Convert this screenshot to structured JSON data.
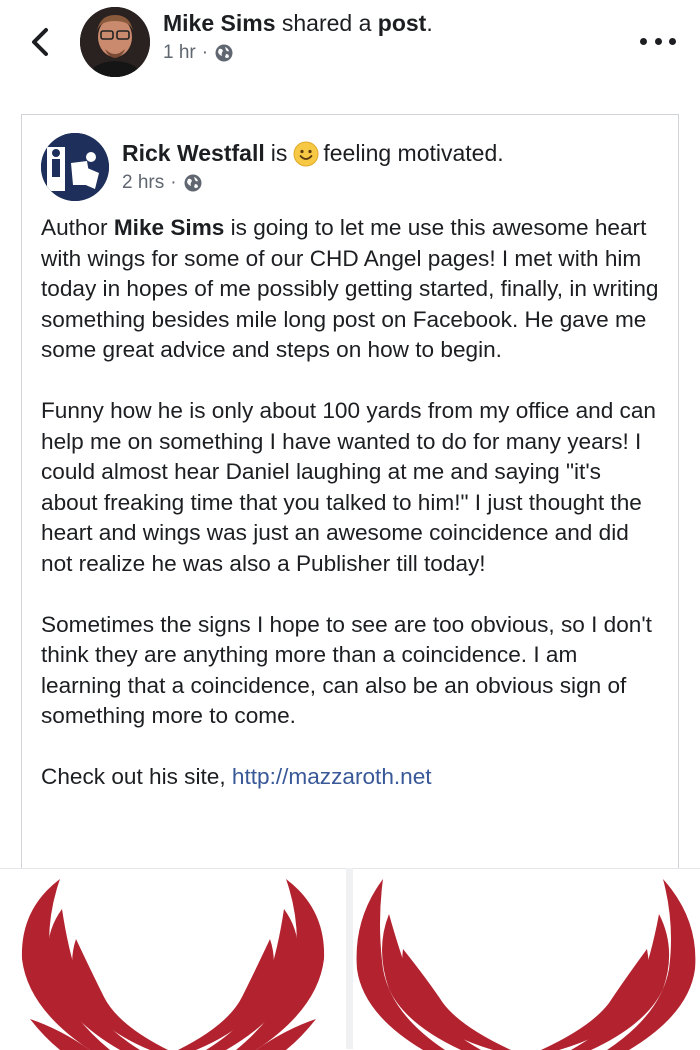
{
  "header": {
    "author": "Mike Sims",
    "action": "shared a",
    "object": "post",
    "time": "1 hr",
    "privacy_icon": "globe-icon"
  },
  "post": {
    "author": "Rick Westfall",
    "is": "is",
    "feeling": "feeling motivated.",
    "feeling_icon": "smiley-emoji",
    "time": "2 hrs",
    "paragraphs": {
      "p1_a": "Author ",
      "p1_name": "Mike Sims",
      "p1_b": " is going to let me use this awesome heart with wings for some of our CHD Angel pages! I met with him today in hopes of me possibly getting started, finally, in writing something besides mile long post on Facebook. He gave me some great advice and steps on how to begin.",
      "p2": "Funny how he is only about 100 yards from my office and can help me on something I have wanted to do for many years! I could almost hear Daniel laughing at me and saying \"it's about freaking time that you talked to him!\" I just thought the heart and wings was just an awesome coincidence and did not realize he was also a Publisher till today!",
      "p3": "Sometimes the signs I hope to see are too obvious, so I don't think they are anything more than a coincidence. I am learning that a coincidence, can also be an obvious sign of something more to come.",
      "p4_a": "Check out his site, ",
      "p4_link": "http://mazzaroth.net"
    }
  },
  "colors": {
    "link": "#385898",
    "wing_red": "#b3232f"
  }
}
